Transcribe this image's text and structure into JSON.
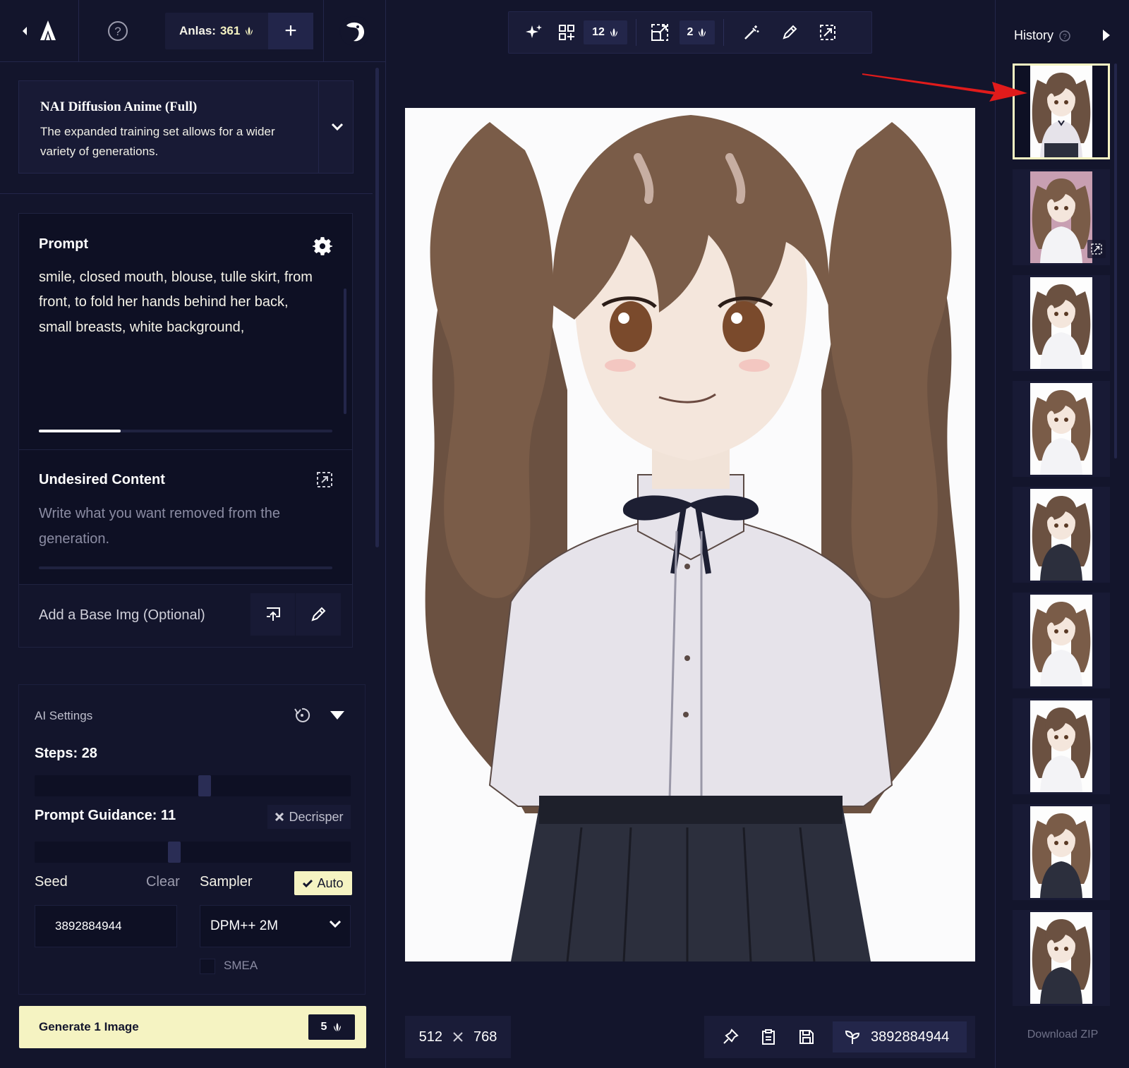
{
  "header": {
    "anlas_label": "Anlas:",
    "anlas_value": "361",
    "add_label": "+"
  },
  "model": {
    "name": "NAI Diffusion Anime (Full)",
    "description": "The expanded training set allows for a wider variety of generations."
  },
  "prompt": {
    "title": "Prompt",
    "text": "best quality, amazing quality, very aesthetic, screencap, upper body, a girl about college-age, wavy hair, brown hair, low twintails, smile, closed mouth, blouse, tulle skirt, from front, to fold her hands behind her back, small breasts, white background,",
    "scroll_progress": 0.28
  },
  "undesired": {
    "title": "Undesired Content",
    "placeholder": "Write what you want removed from the generation."
  },
  "base_image": {
    "label": "Add a Base Img (Optional)"
  },
  "ai_settings": {
    "title": "AI Settings",
    "steps_label": "Steps:",
    "steps_value": "28",
    "steps_fraction": 0.54,
    "guidance_label": "Prompt Guidance:",
    "guidance_value": "11",
    "guidance_fraction": 0.44,
    "decrisper_label": "Decrisper",
    "seed_label": "Seed",
    "clear_label": "Clear",
    "sampler_label": "Sampler",
    "auto_label": "Auto",
    "seed_value": "3892884944",
    "sampler_value": "DPM++ 2M",
    "smea_label": "SMEA"
  },
  "generate": {
    "label": "Generate 1 Image",
    "cost": "5"
  },
  "toolbar": {
    "variations_cost": "12",
    "upscale_cost": "2"
  },
  "canvas": {
    "width": "512",
    "height": "768"
  },
  "actions": {
    "seed": "3892884944"
  },
  "history": {
    "title": "History",
    "download_label": "Download ZIP",
    "thumb_count": 9
  },
  "colors": {
    "background": "#13152c",
    "panel": "#1a1c38",
    "accent": "#f5f3c2",
    "arrow": "#e01b1b"
  }
}
